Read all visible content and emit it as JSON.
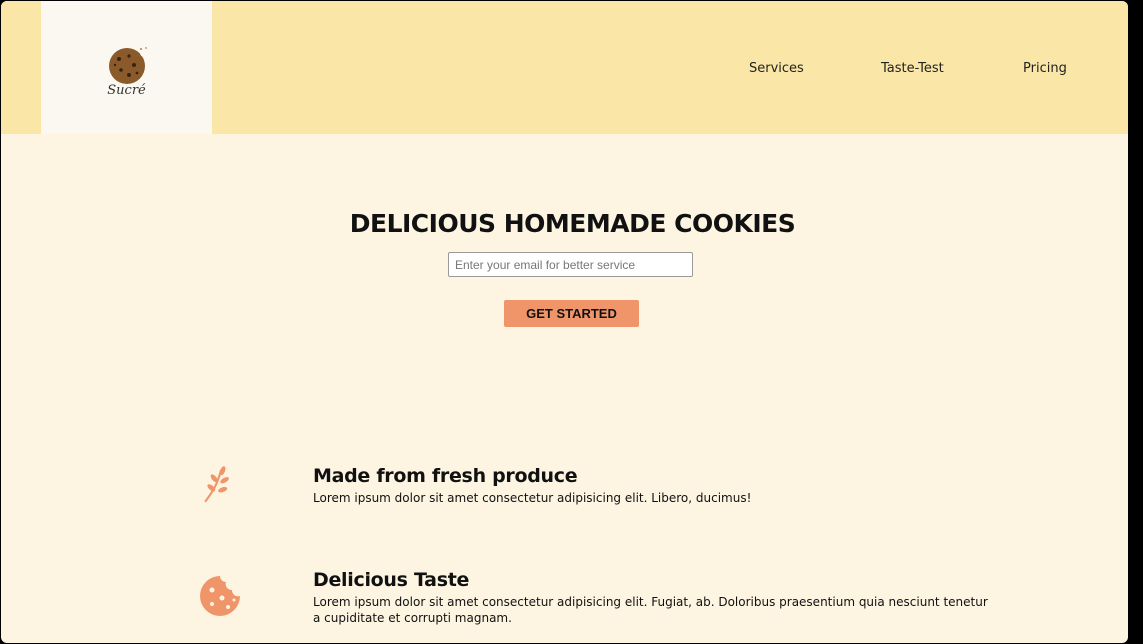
{
  "header": {
    "logo_text": "Sucré",
    "nav": [
      {
        "label": "Services"
      },
      {
        "label": "Taste-Test"
      },
      {
        "label": "Pricing"
      }
    ]
  },
  "hero": {
    "title": "DELICIOUS HOMEMADE COOKIES",
    "email_placeholder": "Enter your email for better service",
    "cta_label": "GET STARTED"
  },
  "features": [
    {
      "icon": "leaf-icon",
      "title": "Made from fresh produce",
      "description": "Lorem ipsum dolor sit amet consectetur adipisicing elit. Libero, ducimus!"
    },
    {
      "icon": "cookie-icon",
      "title": "Delicious Taste",
      "description": "Lorem ipsum dolor sit amet consectetur adipisicing elit. Fugiat, ab. Doloribus praesentium quia nesciunt tenetur a cupiditate et corrupti magnam."
    }
  ],
  "colors": {
    "header_bg": "#fae6a6",
    "page_bg": "#fdf5e2",
    "accent": "#f0956a"
  }
}
